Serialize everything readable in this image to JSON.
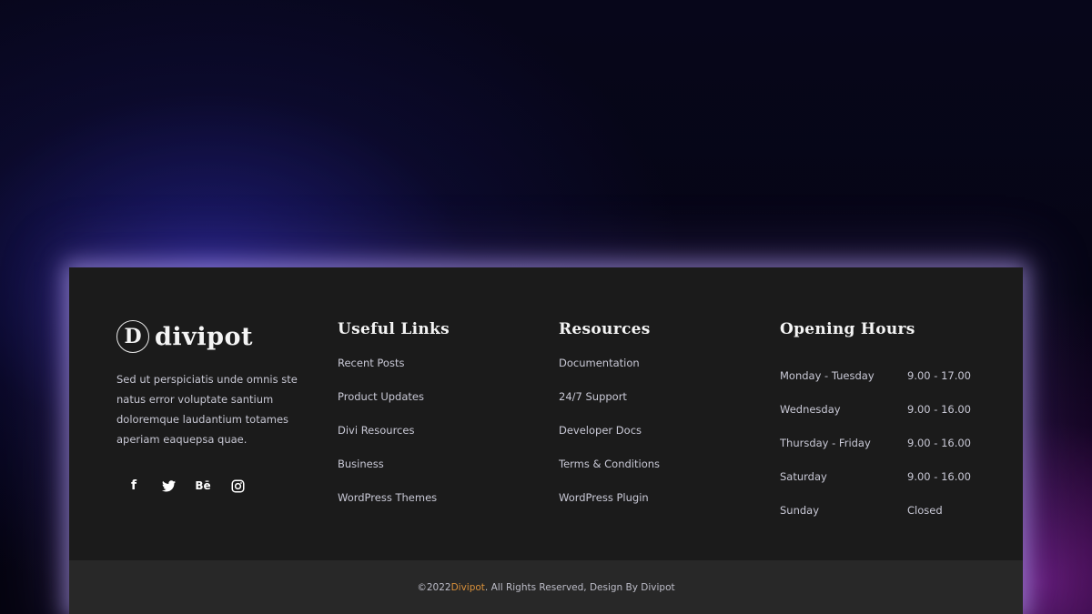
{
  "brand": {
    "logo_letter": "D",
    "name": "divipot",
    "description": "Sed ut perspiciatis unde omnis ste natus error voluptate santium doloremque laudantium totames aperiam eaquepsa quae."
  },
  "social": [
    {
      "icon": "facebook-icon",
      "glyph": "f"
    },
    {
      "icon": "twitter-icon",
      "glyph": "🐦"
    },
    {
      "icon": "behance-icon",
      "glyph": "Bē"
    },
    {
      "icon": "instagram-icon",
      "glyph": "◎"
    }
  ],
  "useful_links": {
    "heading": "Useful Links",
    "items": [
      "Recent Posts",
      "Product Updates",
      "Divi Resources",
      "Business",
      "WordPress Themes"
    ]
  },
  "resources": {
    "heading": "Resources",
    "items": [
      "Documentation",
      "24/7 Support",
      "Developer Docs",
      "Terms & Conditions",
      "WordPress Plugin"
    ]
  },
  "hours": {
    "heading": "Opening Hours",
    "rows": [
      {
        "day": "Monday - Tuesday",
        "time": "9.00 - 17.00"
      },
      {
        "day": "Wednesday",
        "time": "9.00 - 16.00"
      },
      {
        "day": "Thursday - Friday",
        "time": "9.00 - 16.00"
      },
      {
        "day": "Saturday",
        "time": "9.00 - 16.00"
      },
      {
        "day": "Sunday",
        "time": "Closed"
      }
    ]
  },
  "copyright": {
    "prefix": "©2022 ",
    "brand": "Divipot",
    "suffix": ". All Rights Reserved, Design By Divipot"
  },
  "colors": {
    "footer_bg": "#1b1b1b",
    "bottom_bar_bg": "#282828",
    "accent": "#d9903a"
  }
}
